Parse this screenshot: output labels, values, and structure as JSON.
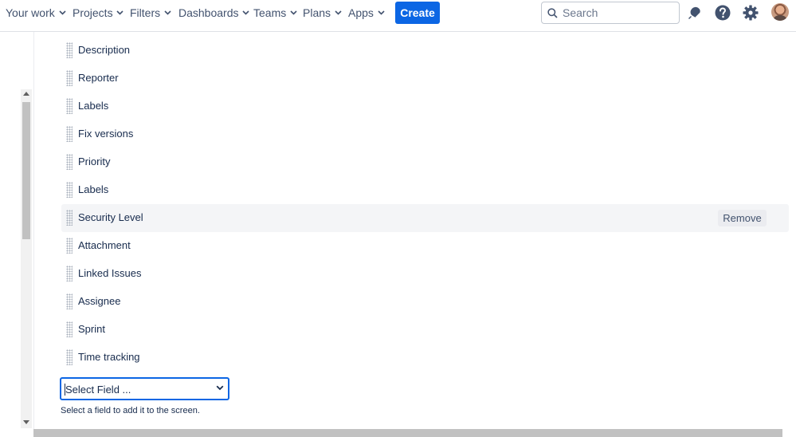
{
  "nav": {
    "items": [
      {
        "label": "Your work"
      },
      {
        "label": "Projects"
      },
      {
        "label": "Filters"
      },
      {
        "label": "Dashboards"
      },
      {
        "label": "Teams"
      },
      {
        "label": "Plans"
      },
      {
        "label": "Apps"
      }
    ],
    "create_label": "Create",
    "search_placeholder": "Search",
    "icons": [
      "notifications-icon",
      "help-icon",
      "settings-icon",
      "profile-avatar"
    ],
    "accent_color": "#0c66e4"
  },
  "fields": [
    {
      "label": "Description"
    },
    {
      "label": "Reporter"
    },
    {
      "label": "Labels"
    },
    {
      "label": "Fix versions"
    },
    {
      "label": "Priority"
    },
    {
      "label": "Labels"
    },
    {
      "label": "Security Level",
      "hovered": true
    },
    {
      "label": "Attachment"
    },
    {
      "label": "Linked Issues"
    },
    {
      "label": "Assignee"
    },
    {
      "label": "Sprint"
    },
    {
      "label": "Time tracking"
    }
  ],
  "remove_label": "Remove",
  "select_field": {
    "value": "Select Field ...",
    "help": "Select a field to add it to the screen."
  }
}
